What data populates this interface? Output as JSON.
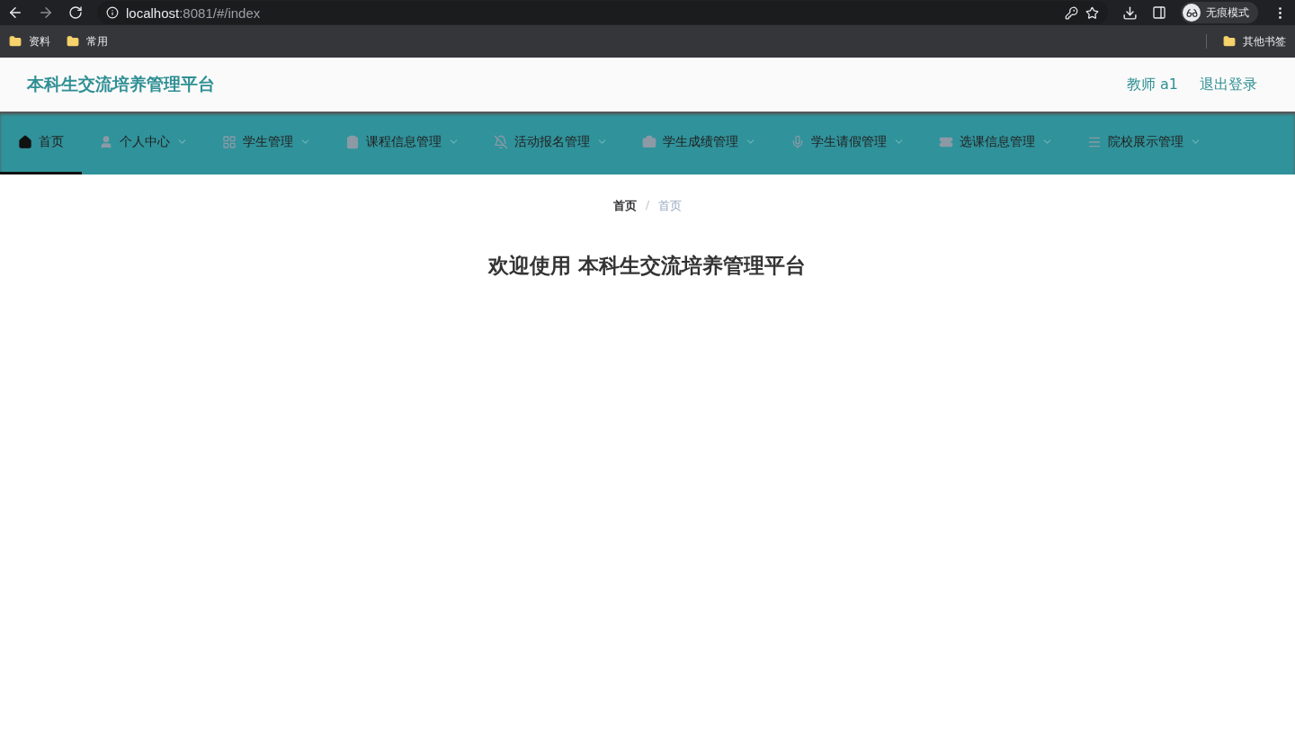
{
  "browser": {
    "url_host": "localhost",
    "url_path": ":8081/#/index",
    "incognito_label": "无痕模式",
    "bookmarks": [
      "资料",
      "常用"
    ],
    "other_bookmarks": "其他书签"
  },
  "header": {
    "title": "本科生交流培养管理平台",
    "user": "教师 a1",
    "logout": "退出登录"
  },
  "nav": [
    {
      "label": "首页",
      "kind": "home",
      "dropdown": false,
      "selected": true
    },
    {
      "label": "个人中心",
      "kind": "user",
      "dropdown": true,
      "selected": false
    },
    {
      "label": "学生管理",
      "kind": "grid",
      "dropdown": true,
      "selected": false
    },
    {
      "label": "课程信息管理",
      "kind": "clipboard",
      "dropdown": true,
      "selected": false
    },
    {
      "label": "活动报名管理",
      "kind": "bell-off",
      "dropdown": true,
      "selected": false
    },
    {
      "label": "学生成绩管理",
      "kind": "briefcase",
      "dropdown": true,
      "selected": false
    },
    {
      "label": "学生请假管理",
      "kind": "mic",
      "dropdown": true,
      "selected": false
    },
    {
      "label": "选课信息管理",
      "kind": "ticket",
      "dropdown": true,
      "selected": false
    },
    {
      "label": "院校展示管理",
      "kind": "list",
      "dropdown": true,
      "selected": false
    }
  ],
  "breadcrumb": [
    "首页",
    "首页"
  ],
  "breadcrumb_separator": "/",
  "welcome": "欢迎使用 本科生交流培养管理平台"
}
